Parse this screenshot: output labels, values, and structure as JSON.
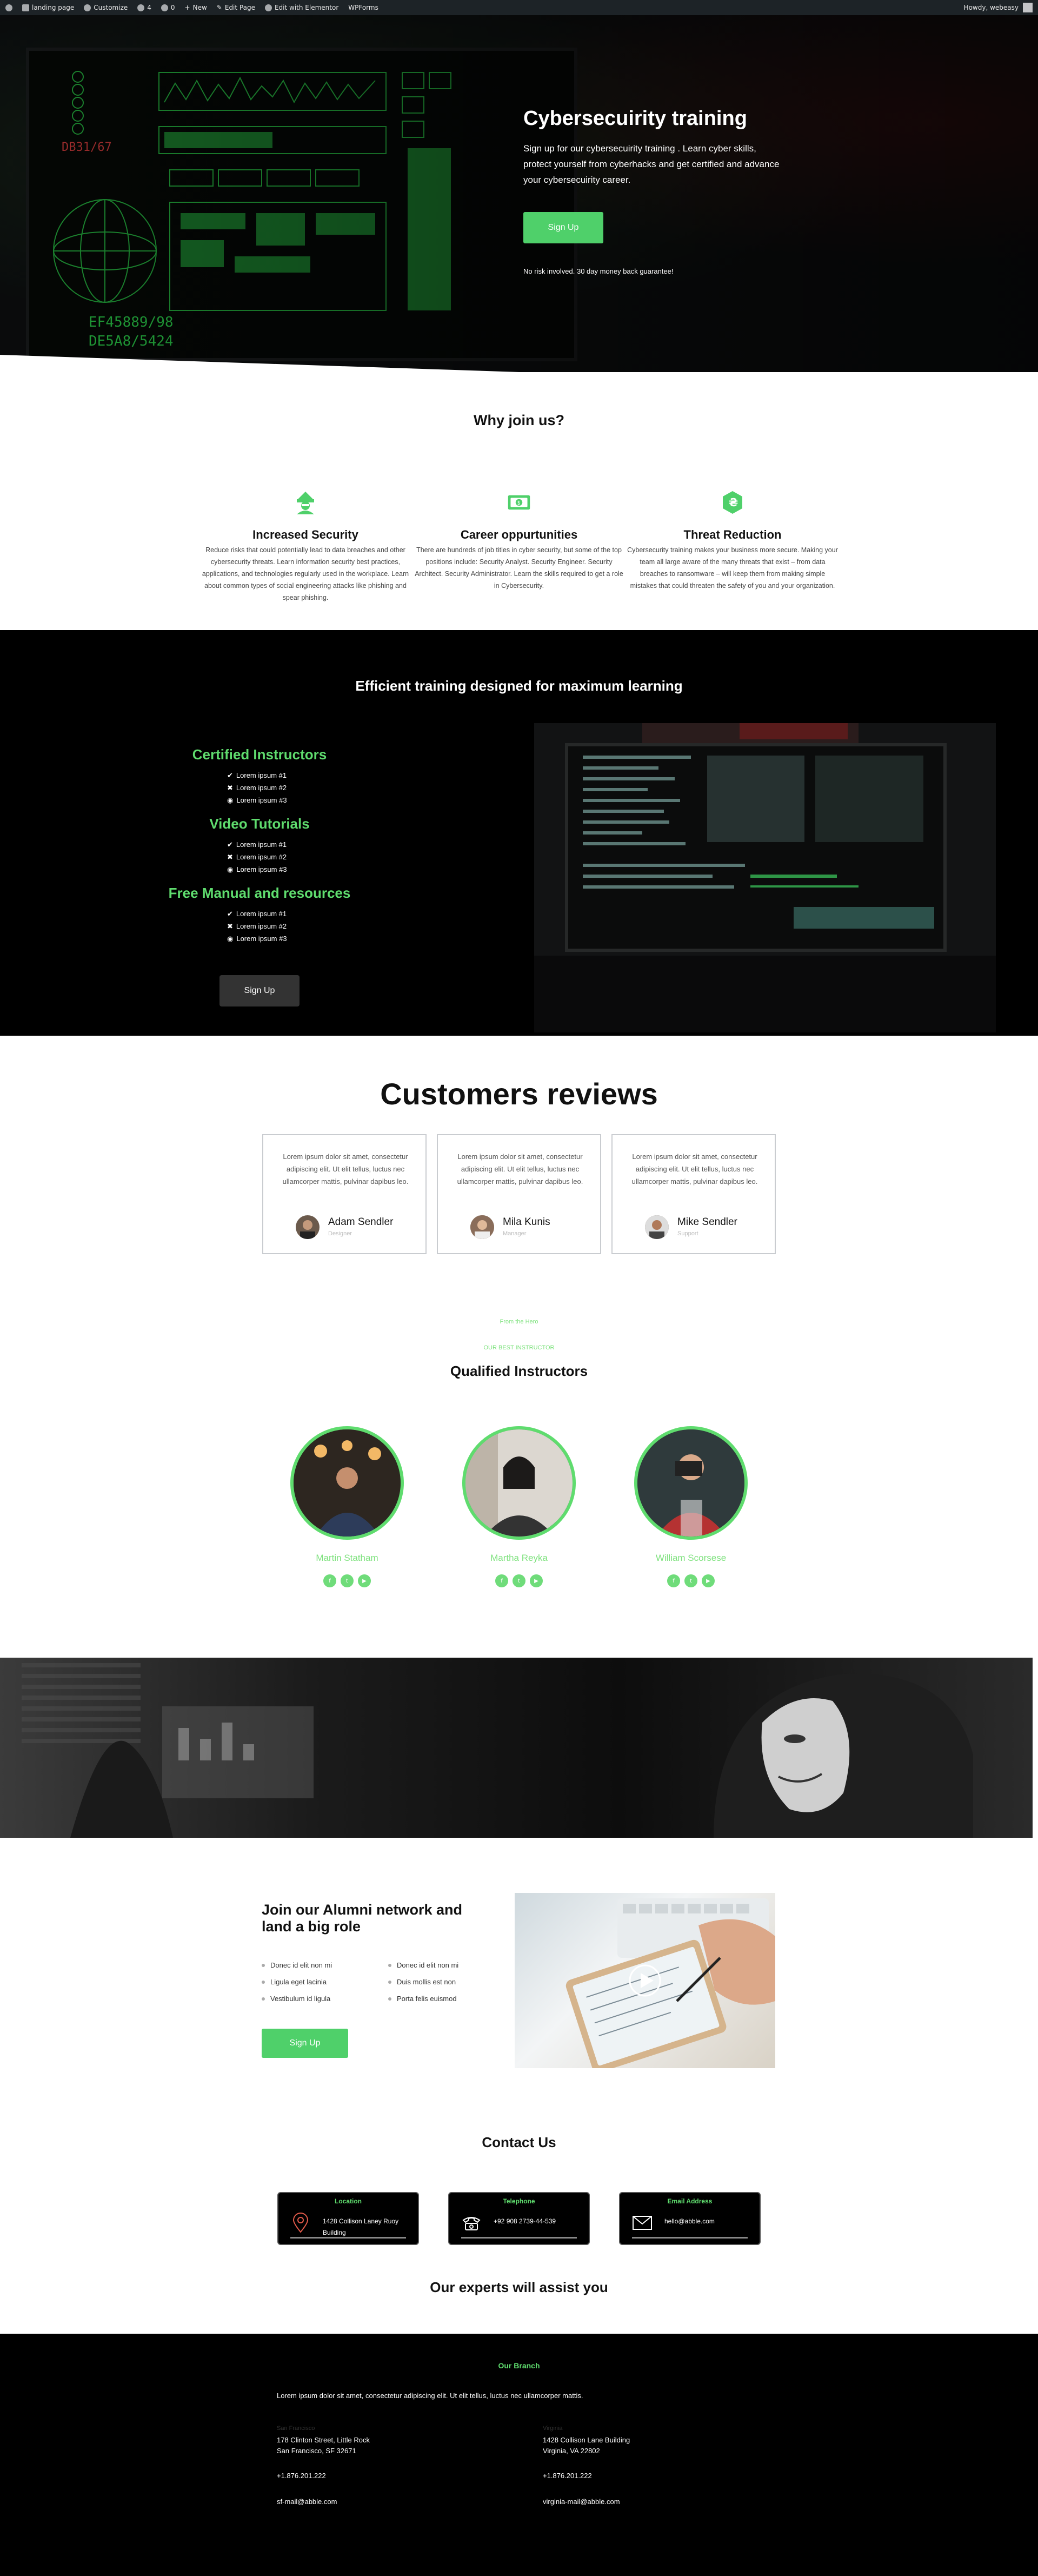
{
  "adminbar": {
    "items": [
      "landing page",
      "Customize",
      "4",
      "0",
      "New",
      "Edit Page",
      "Edit with Elementor",
      "WPForms"
    ],
    "greeting": "Howdy, webeasy"
  },
  "hero": {
    "title": "Cybersecuirity training",
    "text": "Sign up for our cybersecuirity training . Learn cyber skills, protect yourself from cyberhacks and get certified and advance your cybersecuirity career.",
    "button": "Sign Up",
    "note": "No risk involved. 30 day money back guarantee!"
  },
  "why": {
    "title": "Why join us?",
    "features": [
      {
        "icon": "hacker-icon",
        "title": "Increased Security",
        "text": "Reduce risks that could potentially lead to data breaches and other cybersecurity threats. Learn information security best practices, applications, and technologies regularly used in the workplace. Learn about common types of social engineering attacks like phishing and spear phishing."
      },
      {
        "icon": "money-icon",
        "title": "Career oppurtunities",
        "text": "There are hundreds of job titles in cyber security, but some of the top positions include: Security Analyst. Security Engineer. Security Architect. Security Administrator. Learn the skills required to get a role in Cybersecurity."
      },
      {
        "icon": "hryvnia-icon",
        "title": "Threat Reduction",
        "text": "Cybersecurity training makes your business more secure. Making your team all large aware of the many threats that exist – from data breaches to ransomware – will keep them from making simple mistakes that could threaten the safety of you and your organization."
      }
    ]
  },
  "training": {
    "title": "Efficient training designed for maximum learning",
    "groups": [
      {
        "title": "Certified Instructors",
        "items": [
          {
            "icon": "check",
            "text": "Lorem ipsum #1"
          },
          {
            "icon": "times",
            "text": "Lorem ipsum #2"
          },
          {
            "icon": "dot",
            "text": "Lorem ipsum #3"
          }
        ]
      },
      {
        "title": "Video Tutorials",
        "items": [
          {
            "icon": "check",
            "text": "Lorem ipsum #1"
          },
          {
            "icon": "times",
            "text": "Lorem ipsum #2"
          },
          {
            "icon": "dot",
            "text": "Lorem ipsum #3"
          }
        ]
      },
      {
        "title": "Free Manual and resources",
        "items": [
          {
            "icon": "check",
            "text": "Lorem ipsum #1"
          },
          {
            "icon": "times",
            "text": "Lorem ipsum #2"
          },
          {
            "icon": "dot",
            "text": "Lorem ipsum #3"
          }
        ]
      }
    ],
    "button": "Sign Up"
  },
  "reviews": {
    "title": "Customers reviews",
    "items": [
      {
        "text": "Lorem ipsum dolor sit amet, consectetur adipiscing elit. Ut elit tellus, luctus nec ullamcorper mattis, pulvinar dapibus leo.",
        "name": "Adam Sendler",
        "role": "Designer"
      },
      {
        "text": "Lorem ipsum dolor sit amet, consectetur adipiscing elit. Ut elit tellus, luctus nec ullamcorper mattis, pulvinar dapibus leo.",
        "name": "Mila Kunis",
        "role": "Manager"
      },
      {
        "text": "Lorem ipsum dolor sit amet, consectetur adipiscing elit. Ut elit tellus, luctus nec ullamcorper mattis, pulvinar dapibus leo.",
        "name": "Mike Sendler",
        "role": "Support"
      }
    ]
  },
  "instructors": {
    "kicker": "From the Hero",
    "subtitle": "OUR BEST INSTRUCTOR",
    "title": "Qualified Instructors",
    "items": [
      {
        "name": "Martin Statham"
      },
      {
        "name": "Martha Reyka"
      },
      {
        "name": "William Scorsese"
      }
    ]
  },
  "alumni": {
    "title": "Join our Alumni network and land a big role",
    "col1": [
      "Donec id elit non mi",
      "Ligula eget lacinia",
      "Vestibulum id ligula"
    ],
    "col2": [
      "Donec id elit non mi",
      "Duis mollis est non",
      "Porta felis euismod"
    ],
    "button": "Sign Up"
  },
  "contact": {
    "title": "Contact Us",
    "cards": [
      {
        "label": "Location",
        "text": "1428 Collison Laney Ruoy Building"
      },
      {
        "label": "Telephone",
        "text": "+92 908 2739-44-539"
      },
      {
        "label": "Email Address",
        "text": "hello@abble.com"
      }
    ],
    "subtitle": "Our experts will assist you"
  },
  "footer": {
    "title": "Our Branch",
    "intro": "Lorem ipsum dolor sit amet, consectetur adipiscing elit. Ut elit tellus, luctus nec ullamcorper mattis.",
    "branches": [
      {
        "label": "San Francisco",
        "address1": "178 Clinton Street, Little Rock",
        "address2": "San Francisco, SF 32671",
        "phone": "+1.876.201.222",
        "email": "sf-mail@abble.com"
      },
      {
        "label": "Virginia",
        "address1": "1428 Collison Lane Building",
        "address2": "Virginia, VA 22802",
        "phone": "+1.876.201.222",
        "email": "virginia-mail@abble.com"
      }
    ]
  },
  "colors": {
    "accent": "#4fd06a",
    "dark": "#000000"
  }
}
